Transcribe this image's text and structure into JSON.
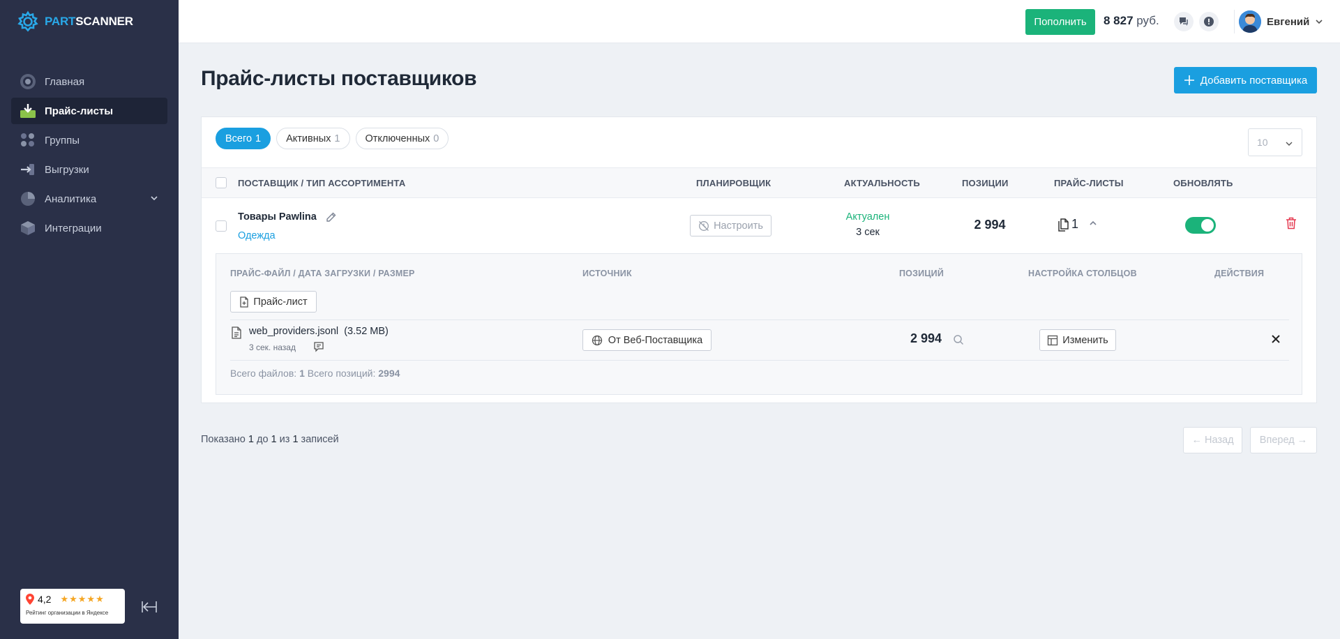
{
  "app": {
    "logo_part": "PART",
    "logo_scanner": "SCANNER"
  },
  "colors": {
    "accent": "#1a9fe0",
    "success": "#1bb37a",
    "danger": "#e53950",
    "sidebar": "#2a3048"
  },
  "sidebar": {
    "items": [
      {
        "label": "Главная",
        "icon": "home-icon",
        "active": false
      },
      {
        "label": "Прайс-листы",
        "icon": "pricelist-icon",
        "active": true
      },
      {
        "label": "Группы",
        "icon": "groups-icon",
        "active": false
      },
      {
        "label": "Выгрузки",
        "icon": "export-icon",
        "active": false
      },
      {
        "label": "Аналитика",
        "icon": "analytics-icon",
        "active": false
      },
      {
        "label": "Интеграции",
        "icon": "integrations-icon",
        "active": false
      }
    ],
    "rating": {
      "value": "4,2",
      "caption": "Рейтинг организации в Яндексе",
      "stars": 4.2
    }
  },
  "topbar": {
    "topup_label": "Пополнить",
    "balance_value": "8 827",
    "balance_currency": "руб.",
    "user_name": "Евгений"
  },
  "page": {
    "title": "Прайс-листы поставщиков",
    "add_button": "Добавить поставщика",
    "filters": [
      {
        "label": "Всего",
        "count": "1",
        "active": true
      },
      {
        "label": "Активных",
        "count": "1",
        "active": false
      },
      {
        "label": "Отключенных",
        "count": "0",
        "active": false
      }
    ],
    "per_page": "10",
    "columns": {
      "supplier": "ПОСТАВЩИК / ТИП АССОРТИМЕНТА",
      "scheduler": "ПЛАНИРОВЩИК",
      "actuality": "АКТУАЛЬНОСТЬ",
      "positions": "ПОЗИЦИИ",
      "pricelists": "ПРАЙС-ЛИСТЫ",
      "update": "ОБНОВЛЯТЬ"
    },
    "row": {
      "supplier_name": "Товары Pawlina",
      "supplier_type": "Одежда",
      "configure_label": "Настроить",
      "actuality_status": "Актуален",
      "actuality_age": "3 сек",
      "positions": "2 994",
      "pricelists_count": "1",
      "update_enabled": true
    },
    "subtable": {
      "columns": {
        "file": "ПРАЙС-ФАЙЛ / ДАТА ЗАГРУЗКИ / РАЗМЕР",
        "source": "ИСТОЧНИК",
        "positions": "ПОЗИЦИЙ",
        "columns_cfg": "НАСТРОЙКА СТОЛБЦОВ",
        "actions": "ДЕЙСТВИЯ"
      },
      "pricelist_button": "Прайс-лист",
      "file_name": "web_providers.jsonl",
      "file_size": "(3.52 MB)",
      "file_date": "3 сек. назад",
      "source_label": "От Веб-Поставщика",
      "positions": "2 994",
      "change_label": "Изменить",
      "summary_files_label": "Всего файлов:",
      "summary_files": "1",
      "summary_positions_label": "Всего позиций:",
      "summary_positions": "2994"
    },
    "pagination": {
      "shown_prefix": "Показано",
      "from": "1",
      "to_word": "до",
      "to": "1",
      "of_word": "из",
      "total": "1",
      "suffix": "записей",
      "prev": "← Назад",
      "next": "Вперед →"
    }
  }
}
